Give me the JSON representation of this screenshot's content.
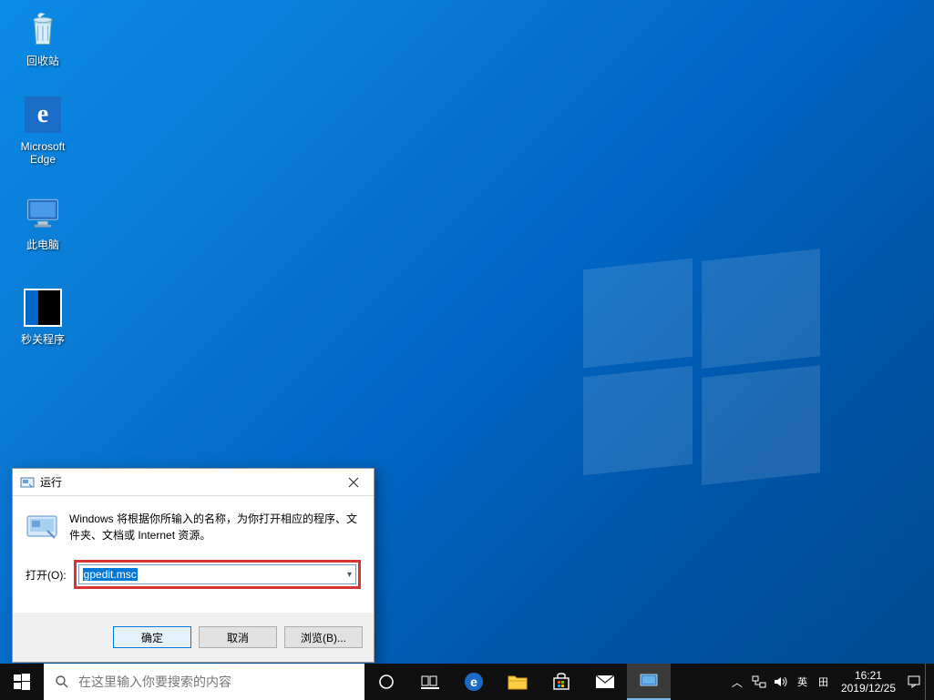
{
  "desktop_icons": {
    "recycle": "回收站",
    "edge": "Microsoft\nEdge",
    "pc": "此电脑",
    "app": "秒关程序"
  },
  "run_dialog": {
    "title": "运行",
    "desc": "Windows 将根据你所输入的名称，为你打开相应的程序、文件夹、文档或 Internet 资源。",
    "open_label": "打开(O):",
    "value": "gpedit.msc",
    "ok": "确定",
    "cancel": "取消",
    "browse": "浏览(B)..."
  },
  "taskbar": {
    "search_placeholder": "在这里输入你要搜索的内容"
  },
  "tray": {
    "ime1": "英",
    "ime2": "田",
    "time": "16:21",
    "date": "2019/12/25"
  }
}
